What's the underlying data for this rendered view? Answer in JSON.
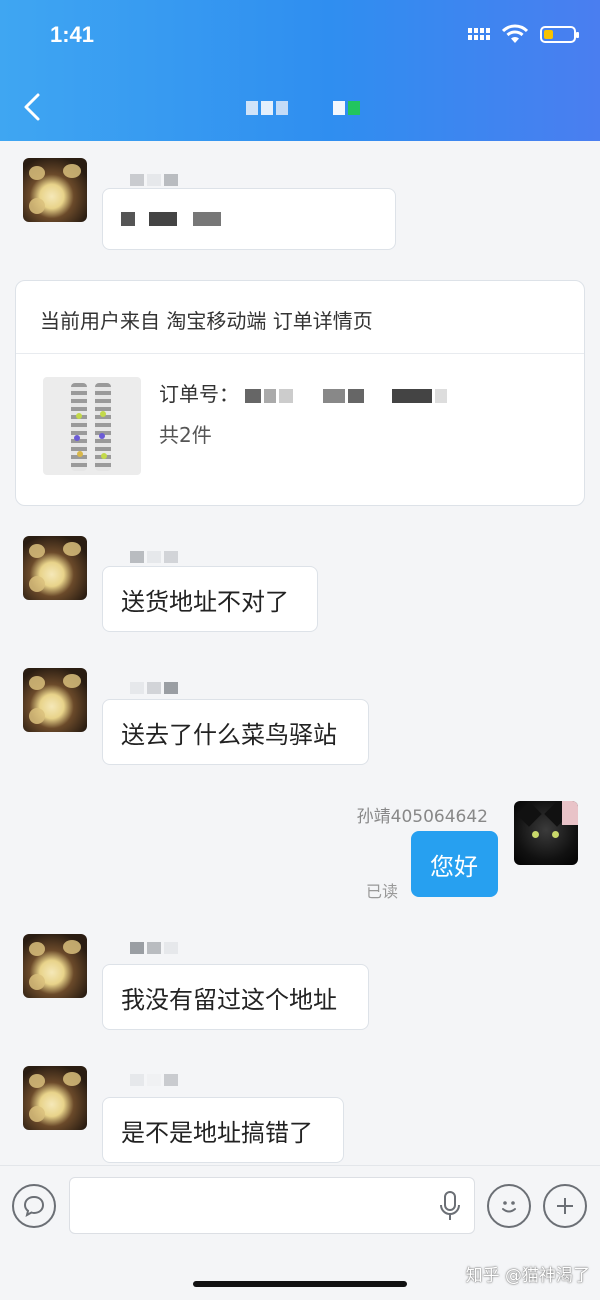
{
  "status_bar": {
    "time": "1:41"
  },
  "order_card": {
    "source": "当前用户来自 淘宝移动端 订单详情页",
    "order_number_label": "订单号：",
    "item_count": "共2件"
  },
  "messages": [
    {
      "from": "customer",
      "text": "送货地址不对了"
    },
    {
      "from": "customer",
      "text": "送去了什么菜鸟驿站"
    },
    {
      "from": "me",
      "sender": "孙靖405064642",
      "text": "您好",
      "status": "已读"
    },
    {
      "from": "customer",
      "text": "我没有留过这个地址"
    },
    {
      "from": "customer",
      "text": "是不是地址搞错了"
    }
  ],
  "watermark": "知乎 @猫神渴了",
  "colors": {
    "header_gradient_start": "#3fa6f2",
    "header_gradient_end": "#4a7ef0",
    "my_bubble": "#27a0f0",
    "battery": "#f7c300"
  },
  "icons": [
    "back-icon",
    "signal-icon",
    "wifi-icon",
    "battery-icon",
    "voice-icon",
    "microphone-icon",
    "emoji-icon",
    "plus-icon"
  ]
}
